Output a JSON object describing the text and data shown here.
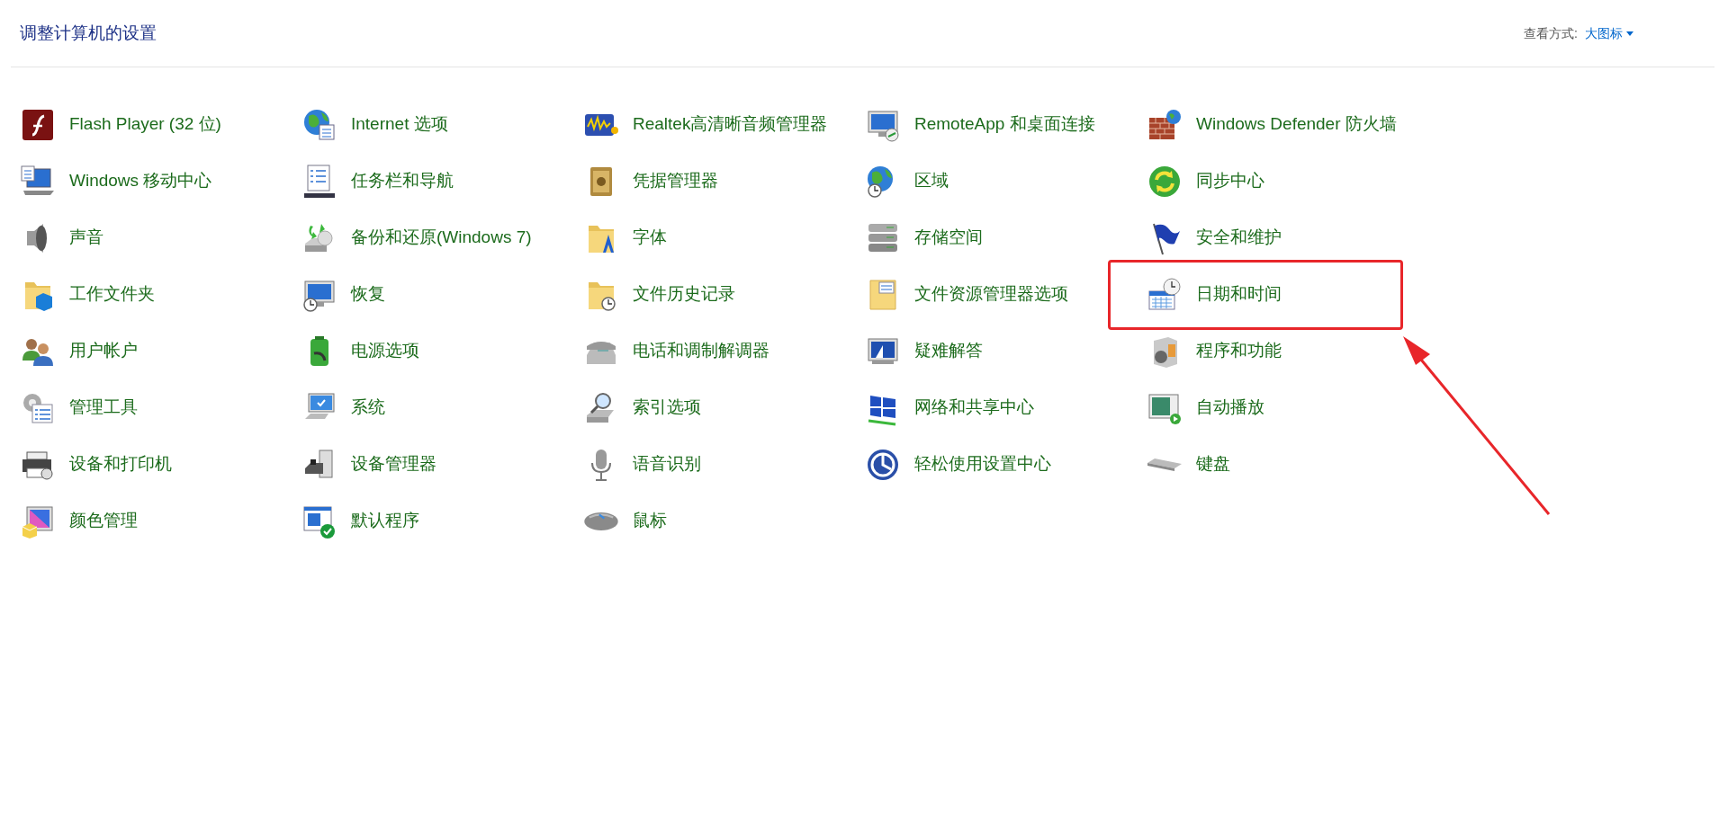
{
  "header": {
    "title": "调整计算机的设置",
    "view_label": "查看方式:",
    "view_value": "大图标"
  },
  "items": [
    {
      "label": "Flash Player (32 位)",
      "highlighted": false
    },
    {
      "label": "Internet 选项",
      "highlighted": false
    },
    {
      "label": "Realtek高清晰音频管理器",
      "highlighted": false
    },
    {
      "label": "RemoteApp 和桌面连接",
      "highlighted": false
    },
    {
      "label": "Windows Defender 防火墙",
      "highlighted": false
    },
    {
      "label": "Windows 移动中心",
      "highlighted": false
    },
    {
      "label": "任务栏和导航",
      "highlighted": false
    },
    {
      "label": "凭据管理器",
      "highlighted": false
    },
    {
      "label": "区域",
      "highlighted": false
    },
    {
      "label": "同步中心",
      "highlighted": false
    },
    {
      "label": "声音",
      "highlighted": false
    },
    {
      "label": "备份和还原(Windows 7)",
      "highlighted": false
    },
    {
      "label": "字体",
      "highlighted": false
    },
    {
      "label": "存储空间",
      "highlighted": false
    },
    {
      "label": "安全和维护",
      "highlighted": false
    },
    {
      "label": "工作文件夹",
      "highlighted": false
    },
    {
      "label": "恢复",
      "highlighted": false
    },
    {
      "label": "文件历史记录",
      "highlighted": false
    },
    {
      "label": "文件资源管理器选项",
      "highlighted": false
    },
    {
      "label": "日期和时间",
      "highlighted": true
    },
    {
      "label": "用户帐户",
      "highlighted": false
    },
    {
      "label": "电源选项",
      "highlighted": false
    },
    {
      "label": "电话和调制解调器",
      "highlighted": false
    },
    {
      "label": "疑难解答",
      "highlighted": false
    },
    {
      "label": "程序和功能",
      "highlighted": false
    },
    {
      "label": "管理工具",
      "highlighted": false
    },
    {
      "label": "系统",
      "highlighted": false
    },
    {
      "label": "索引选项",
      "highlighted": false
    },
    {
      "label": "网络和共享中心",
      "highlighted": false
    },
    {
      "label": "自动播放",
      "highlighted": false
    },
    {
      "label": "设备和打印机",
      "highlighted": false
    },
    {
      "label": "设备管理器",
      "highlighted": false
    },
    {
      "label": "语音识别",
      "highlighted": false
    },
    {
      "label": "轻松使用设置中心",
      "highlighted": false
    },
    {
      "label": "键盘",
      "highlighted": false
    },
    {
      "label": "颜色管理",
      "highlighted": false
    },
    {
      "label": "默认程序",
      "highlighted": false
    },
    {
      "label": "鼠标",
      "highlighted": false
    }
  ]
}
